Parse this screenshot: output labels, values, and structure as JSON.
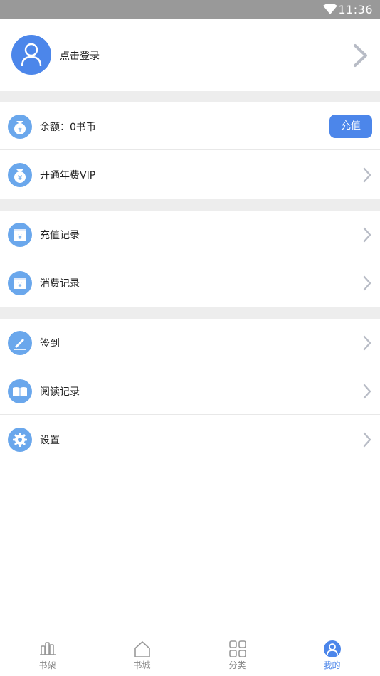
{
  "status_bar": {
    "time": "11:36"
  },
  "profile": {
    "login_text": "点击登录"
  },
  "rows": [
    {
      "label": "余额：0书币",
      "button": "充值"
    },
    {
      "label": "开通年费VIP"
    },
    {
      "label": "充值记录"
    },
    {
      "label": "消费记录"
    },
    {
      "label": "签到"
    },
    {
      "label": "阅读记录"
    },
    {
      "label": "设置"
    }
  ],
  "tabs": [
    {
      "label": "书架"
    },
    {
      "label": "书城"
    },
    {
      "label": "分类"
    },
    {
      "label": "我的"
    }
  ],
  "colors": {
    "accent": "#4c86ea",
    "icon_bg": "#6aa7ec",
    "gap": "#ededed",
    "statusbar": "#999999"
  },
  "icons": [
    "wifi-icon",
    "user-icon",
    "money-bag-icon",
    "receipt-icon",
    "pen-icon",
    "book-icon",
    "gear-icon",
    "chevron-right-icon",
    "bookshelf-icon",
    "home-icon",
    "grid-icon",
    "profile-icon"
  ]
}
